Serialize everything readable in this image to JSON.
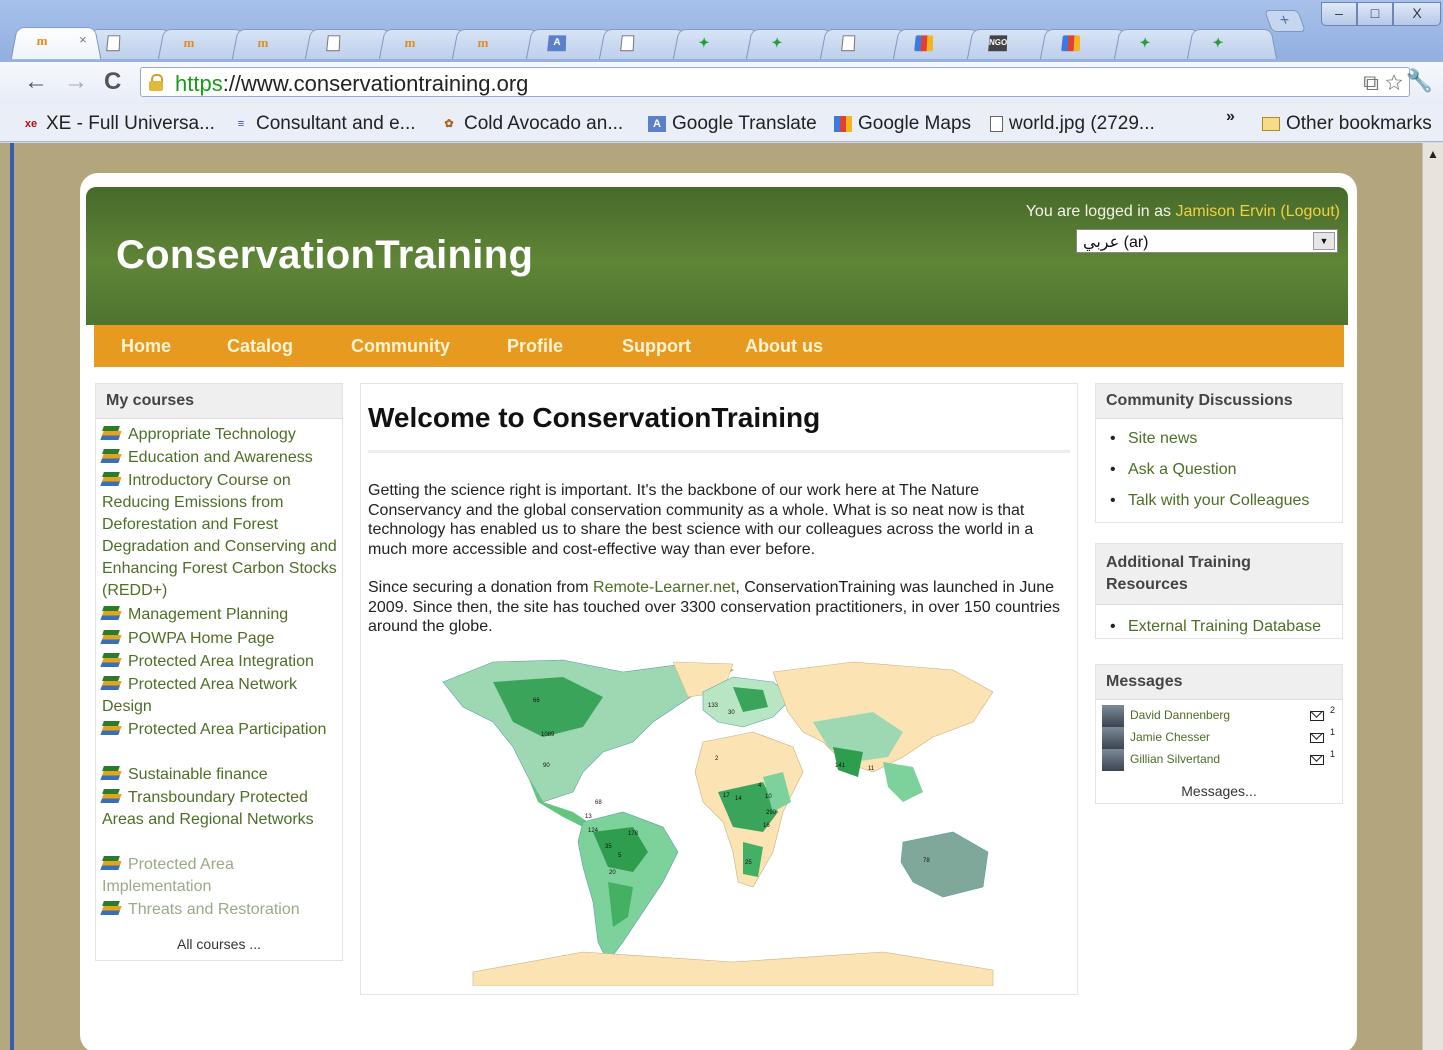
{
  "browser": {
    "tabs": [
      {
        "icon": "moodle-icon",
        "label": "m",
        "active": true,
        "closable": true
      },
      {
        "icon": "page-icon",
        "label": ""
      },
      {
        "icon": "moodle-icon",
        "label": "m"
      },
      {
        "icon": "moodle-icon",
        "label": "m"
      },
      {
        "icon": "page-icon",
        "label": ""
      },
      {
        "icon": "moodle-icon",
        "label": "m"
      },
      {
        "icon": "moodle-icon",
        "label": "m"
      },
      {
        "icon": "translate-icon",
        "label": "A"
      },
      {
        "icon": "page-icon",
        "label": ""
      },
      {
        "icon": "green-leaf-icon",
        "label": "✦"
      },
      {
        "icon": "green-leaf-icon",
        "label": "✦"
      },
      {
        "icon": "page-icon",
        "label": ""
      },
      {
        "icon": "google-maps-icon",
        "label": ""
      },
      {
        "icon": "ngo-icon",
        "label": "NGO"
      },
      {
        "icon": "google-maps-icon",
        "label": ""
      },
      {
        "icon": "green-leaf-icon",
        "label": "✦"
      },
      {
        "icon": "green-leaf-icon",
        "label": "✦"
      }
    ],
    "new_tab_label": "+",
    "window_controls": {
      "minimize": "–",
      "maximize": "□",
      "close": "X"
    },
    "nav": {
      "back": "←",
      "forward": "→",
      "reload": "C"
    },
    "url_scheme": "https",
    "url_rest": "://www.conservationtraining.org",
    "omnibox_icons": "⧉ ☆",
    "wrench": "🔧",
    "bookmarks": [
      {
        "icon": "xe-icon",
        "glyph": "xe",
        "label": "XE - Full Universa..."
      },
      {
        "icon": "consultant-icon",
        "glyph": "≡",
        "label": "Consultant and e..."
      },
      {
        "icon": "avocado-icon",
        "glyph": "✿",
        "label": "Cold Avocado an..."
      },
      {
        "icon": "translate-icon",
        "glyph": "A",
        "label": "Google Translate"
      },
      {
        "icon": "google-maps-icon",
        "glyph": "",
        "label": "Google Maps"
      },
      {
        "icon": "page-icon",
        "glyph": "",
        "label": "world.jpg (2729..."
      }
    ],
    "bookmarks_overflow": "»",
    "other_bookmarks": "Other bookmarks"
  },
  "header": {
    "site_name": "ConservationTraining",
    "login_prefix": "You are logged in as ",
    "user_name": "Jamison Ervin",
    "logout": "(Logout)",
    "language": "عربي (ar)"
  },
  "menu": [
    "Home",
    "Catalog",
    "Community",
    "Profile",
    "Support",
    "About us"
  ],
  "my_courses": {
    "title": "My courses",
    "items": [
      {
        "label": "Appropriate Technology",
        "dim": false
      },
      {
        "label": "Education and Awareness",
        "dim": false
      },
      {
        "label": "Introductory Course on Reducing Emissions from Deforestation and Forest Degradation and Conserving and Enhancing Forest Carbon Stocks (REDD+)",
        "dim": false
      },
      {
        "label": "Management Planning",
        "dim": false
      },
      {
        "label": "POWPA Home Page",
        "dim": false
      },
      {
        "label": "Protected Area Integration",
        "dim": false
      },
      {
        "label": "Protected Area Network Design",
        "dim": false
      },
      {
        "label": "Protected Area Participation",
        "dim": false
      },
      {
        "label": "Sustainable finance",
        "dim": false
      },
      {
        "label": "Transboundary Protected Areas and Regional Networks",
        "dim": false
      },
      {
        "label": "Protected Area Implementation",
        "dim": true
      },
      {
        "label": "Threats and Restoration",
        "dim": true
      }
    ],
    "all_courses": "All courses ..."
  },
  "main": {
    "title": "Welcome to ConservationTraining",
    "para1": "Getting the science right is important. It's the backbone of our work here at The Nature Conservancy and the global conservation community as a whole. What is so neat now is that technology has enabled us to share the best science with our colleagues across the world in a much more accessible and cost-effective way than ever before.",
    "para2_pre": "Since securing a donation from ",
    "para2_link": "Remote-Learner.net",
    "para2_post": ", ConservationTraining was launched in June 2009. Since then, the site has touched over 3300 conservation practitioners, in over 150 countries around the globe.",
    "map_labels": [
      "66",
      "1089",
      "90",
      "68",
      "13",
      "124",
      "178",
      "35",
      "5",
      "20",
      "133",
      "30",
      "2",
      "17",
      "14",
      "4",
      "10",
      "16",
      "290",
      "25",
      "141",
      "11",
      "78"
    ]
  },
  "community": {
    "title": "Community Discussions",
    "items": [
      "Site news",
      "Ask a Question",
      "Talk with your Colleagues"
    ]
  },
  "resources": {
    "title": "Additional Training Resources",
    "items": [
      "External Training Database"
    ]
  },
  "messages": {
    "title": "Messages",
    "items": [
      {
        "name": "David Dannenberg",
        "count": "2"
      },
      {
        "name": "Jamie Chesser",
        "count": "1"
      },
      {
        "name": "Gillian Silvertand",
        "count": "1"
      }
    ],
    "link": "Messages..."
  },
  "colors": {
    "header_green": "#5f8537",
    "menu_orange": "#e79a20",
    "link_green": "#4d6e26"
  }
}
